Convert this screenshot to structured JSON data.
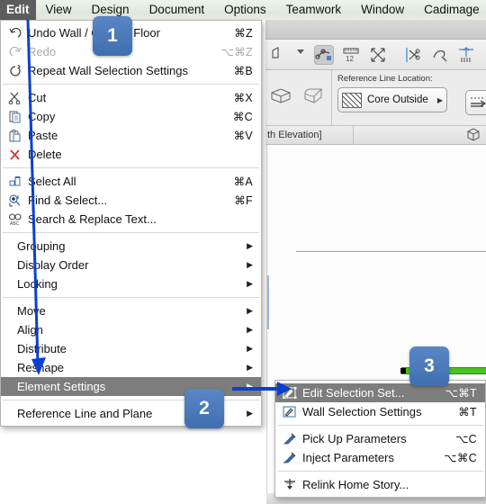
{
  "menubar": {
    "items": [
      {
        "label": "Edit",
        "active": true
      },
      {
        "label": "View",
        "active": false
      },
      {
        "label": "Design",
        "active": false
      },
      {
        "label": "Document",
        "active": false
      },
      {
        "label": "Options",
        "active": false
      },
      {
        "label": "Teamwork",
        "active": false
      },
      {
        "label": "Window",
        "active": false
      },
      {
        "label": "Cadimage",
        "active": false
      }
    ]
  },
  "info_panel": {
    "reference_line_label": "Reference Line Location:",
    "reference_line_value": "Core Outside"
  },
  "document_title": "th Elevation]",
  "edit_menu": {
    "items": [
      {
        "label": "Undo Wall / Ground Floor",
        "shortcut": "⌘Z",
        "icon": "undo-icon",
        "disabled": false,
        "submenu": false
      },
      {
        "label": "Redo",
        "shortcut": "⌥⌘Z",
        "icon": "redo-icon",
        "disabled": true,
        "submenu": false
      },
      {
        "label": "Repeat Wall Selection Settings",
        "shortcut": "⌘B",
        "icon": "repeat-icon",
        "disabled": false,
        "submenu": false
      },
      {
        "separator": true
      },
      {
        "label": "Cut",
        "shortcut": "⌘X",
        "icon": "scissors-icon",
        "disabled": false,
        "submenu": false
      },
      {
        "label": "Copy",
        "shortcut": "⌘C",
        "icon": "copy-icon",
        "disabled": false,
        "submenu": false
      },
      {
        "label": "Paste",
        "shortcut": "⌘V",
        "icon": "clipboard-icon",
        "disabled": false,
        "submenu": false
      },
      {
        "label": "Delete",
        "shortcut": "",
        "icon": "delete-x-icon",
        "disabled": false,
        "submenu": false
      },
      {
        "separator": true
      },
      {
        "label": "Select All",
        "shortcut": "⌘A",
        "icon": "select-all-icon",
        "disabled": false,
        "submenu": false
      },
      {
        "label": "Find & Select...",
        "shortcut": "⌘F",
        "icon": "find-select-icon",
        "disabled": false,
        "submenu": false
      },
      {
        "label": "Search & Replace Text...",
        "shortcut": "",
        "icon": "search-replace-icon",
        "disabled": false,
        "submenu": false
      },
      {
        "separator": true
      },
      {
        "label": "Grouping",
        "shortcut": "",
        "icon": "",
        "disabled": false,
        "submenu": true
      },
      {
        "label": "Display Order",
        "shortcut": "",
        "icon": "",
        "disabled": false,
        "submenu": true
      },
      {
        "label": "Locking",
        "shortcut": "",
        "icon": "",
        "disabled": false,
        "submenu": true
      },
      {
        "separator": true
      },
      {
        "label": "Move",
        "shortcut": "",
        "icon": "",
        "disabled": false,
        "submenu": true
      },
      {
        "label": "Align",
        "shortcut": "",
        "icon": "",
        "disabled": false,
        "submenu": true
      },
      {
        "label": "Distribute",
        "shortcut": "",
        "icon": "",
        "disabled": false,
        "submenu": true
      },
      {
        "label": "Reshape",
        "shortcut": "",
        "icon": "",
        "disabled": false,
        "submenu": true
      },
      {
        "label": "Element Settings",
        "shortcut": "",
        "icon": "",
        "disabled": false,
        "submenu": true,
        "highlight": true
      },
      {
        "separator": true
      },
      {
        "label": "Reference Line and Plane",
        "shortcut": "",
        "icon": "",
        "disabled": false,
        "submenu": true
      }
    ]
  },
  "submenu": {
    "items": [
      {
        "label": "Edit Selection Set...",
        "shortcut": "⌥⌘T",
        "icon": "edit-selection-icon",
        "highlight": true
      },
      {
        "label": "Wall Selection Settings",
        "shortcut": "⌘T",
        "icon": "wall-selection-icon",
        "highlight": false
      },
      {
        "separator": true
      },
      {
        "label": "Pick Up Parameters",
        "shortcut": "⌥C",
        "icon": "eyedropper-icon",
        "highlight": false
      },
      {
        "label": "Inject Parameters",
        "shortcut": "⌥⌘C",
        "icon": "syringe-icon",
        "highlight": false
      },
      {
        "separator": true
      },
      {
        "label": "Relink Home Story...",
        "shortcut": "",
        "icon": "relink-icon",
        "highlight": false
      }
    ]
  },
  "annotations": {
    "badges": [
      {
        "number": "1"
      },
      {
        "number": "2"
      },
      {
        "number": "3"
      }
    ],
    "accent_color": "#3f6fb0",
    "arrow_color": "#0a3fd0"
  },
  "colors": {
    "wall_green": "#49c223",
    "menu_highlight": "#7d7d7d",
    "menubar_active": "#5d5d5d"
  }
}
